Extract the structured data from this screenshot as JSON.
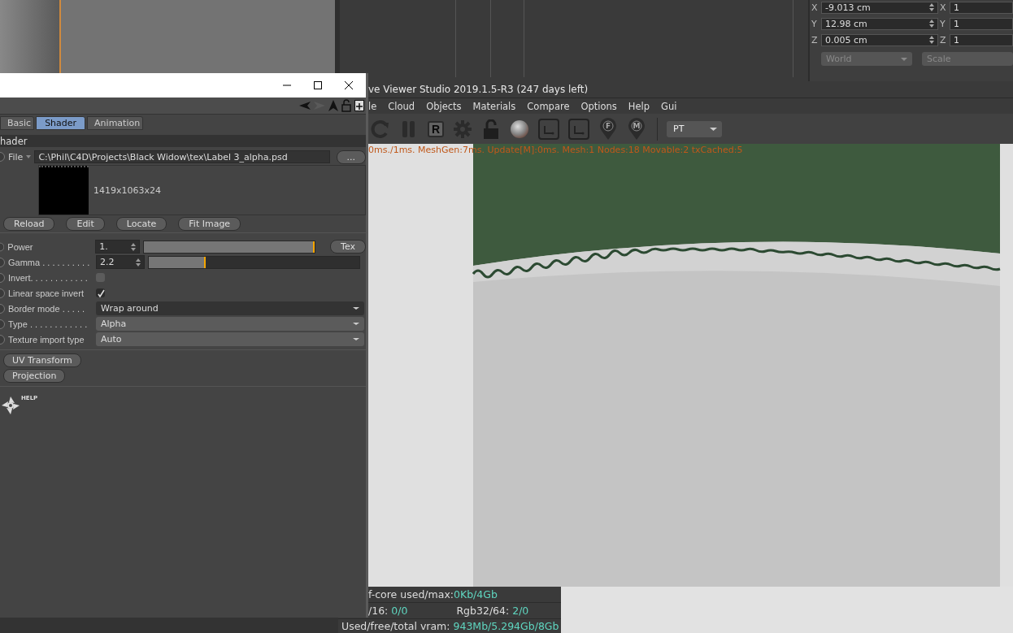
{
  "top_panel": {
    "coords": [
      {
        "axis": "X",
        "value": "-9.013 cm",
        "axis2": "X",
        "value2": "1"
      },
      {
        "axis": "Y",
        "value": "12.98 cm",
        "axis2": "Y",
        "value2": "1"
      },
      {
        "axis": "Z",
        "value": "0.005 cm",
        "axis2": "Z",
        "value2": "1"
      }
    ],
    "dropdowns": [
      {
        "label": "World",
        "disabled": true
      },
      {
        "label": "Scale",
        "disabled": true
      }
    ]
  },
  "viewer": {
    "title": "ve Viewer Studio 2019.1.5-R3 (247 days left)",
    "menu": [
      "le",
      "Cloud",
      "Objects",
      "Materials",
      "Compare",
      "Options",
      "Help",
      "Gui"
    ],
    "tools": [
      {
        "kind": "refresh"
      },
      {
        "kind": "pause"
      },
      {
        "kind": "letterbox",
        "letter": "R"
      },
      {
        "kind": "gear"
      },
      {
        "kind": "lock"
      },
      {
        "kind": "sphere"
      },
      {
        "kind": "square"
      },
      {
        "kind": "square"
      },
      {
        "kind": "pin",
        "letter": "F"
      },
      {
        "kind": "pin",
        "letter": "M"
      }
    ],
    "mode": "PT",
    "status": "0ms./1ms. MeshGen:7ms. Update[M]:0ms. Mesh:1 Nodes:18 Movable:2 txCached:5",
    "stats": [
      [
        {
          "label": "f-core used/max:",
          "value": "0Kb/4Gb"
        }
      ],
      [
        {
          "label": "/16: ",
          "value": "0/0"
        },
        {
          "label": "Rgb32/64: ",
          "value": "2/0"
        }
      ],
      [
        {
          "label": "Used/free/total vram: ",
          "value": "943Mb/5.294Gb/8Gb"
        }
      ]
    ]
  },
  "shader_window": {
    "tabs": [
      {
        "label": "Basic",
        "selected": false
      },
      {
        "label": "Shader",
        "selected": true
      },
      {
        "label": "Animation",
        "selected": false
      }
    ],
    "section": "hader",
    "file": {
      "label": "File",
      "path": "C:\\Phil\\C4D\\Projects\\Black Widow\\tex\\Label 3_alpha.psd",
      "browse": "..."
    },
    "image_info": "1419x1063x24",
    "image_buttons": [
      "Reload",
      "Edit",
      "Locate",
      "Fit Image"
    ],
    "params": [
      {
        "kind": "slider",
        "label": "Power",
        "value": "1.",
        "level": 1.0,
        "button": "Tex"
      },
      {
        "kind": "slider",
        "label": "Gamma . . . . . . . . . .",
        "value": "2.2",
        "level": 0.27
      },
      {
        "kind": "checkbox",
        "label": "Invert. . . . . . . . . . . .",
        "checked": false
      },
      {
        "kind": "checkbox",
        "label": "Linear space invert",
        "checked": true
      },
      {
        "kind": "dropdown",
        "label": "Border mode . . . . .",
        "value": "Wrap around",
        "dark": true
      },
      {
        "kind": "dropdown",
        "label": "Type . . . . . . . . . . . .",
        "value": "Alpha",
        "dark": false
      },
      {
        "kind": "dropdown",
        "label": "Texture import type",
        "value": "Auto",
        "dark": false
      }
    ],
    "groups": [
      "UV Transform",
      "Projection"
    ],
    "help": "HELP"
  }
}
